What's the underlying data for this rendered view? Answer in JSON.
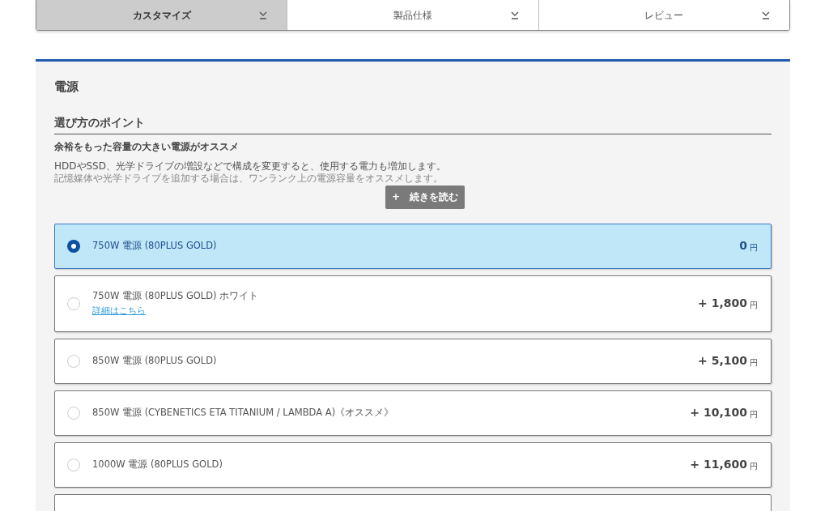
{
  "tabs": [
    {
      "label": "カスタマイズ",
      "selected": true
    },
    {
      "label": "製品仕様",
      "selected": false
    },
    {
      "label": "レビュー",
      "selected": false
    }
  ],
  "section": {
    "title": "電源",
    "subtitle": "選び方のポイント",
    "lead": "余裕をもった容量の大きい電源がオススメ",
    "body": [
      "HDDやSSD、光学ドライブの増設などで構成を変更すると、使用する電力も増加します。",
      "記憶媒体や光学ドライブを追加する場合は、ワンランク上の電源容量をオススメします。"
    ],
    "more_button": "+　続きを読む"
  },
  "options": [
    {
      "label": "750W 電源 (80PLUS GOLD)",
      "price": "0",
      "unit": "円",
      "selected": true
    },
    {
      "label": "750W 電源 (80PLUS GOLD) ホワイト",
      "link": "詳細はこちら",
      "price": "+ 1,800",
      "unit": "円",
      "selected": false
    },
    {
      "label": "850W 電源 (80PLUS GOLD)",
      "price": "+ 5,100",
      "unit": "円",
      "selected": false
    },
    {
      "label": "850W 電源 (CYBENETICS ETA TITANIUM / LAMBDA A)《オススメ》",
      "price": "+ 10,100",
      "unit": "円",
      "selected": false
    },
    {
      "label": "1000W 電源 (80PLUS GOLD)",
      "price": "+ 11,600",
      "unit": "円",
      "selected": false
    }
  ]
}
